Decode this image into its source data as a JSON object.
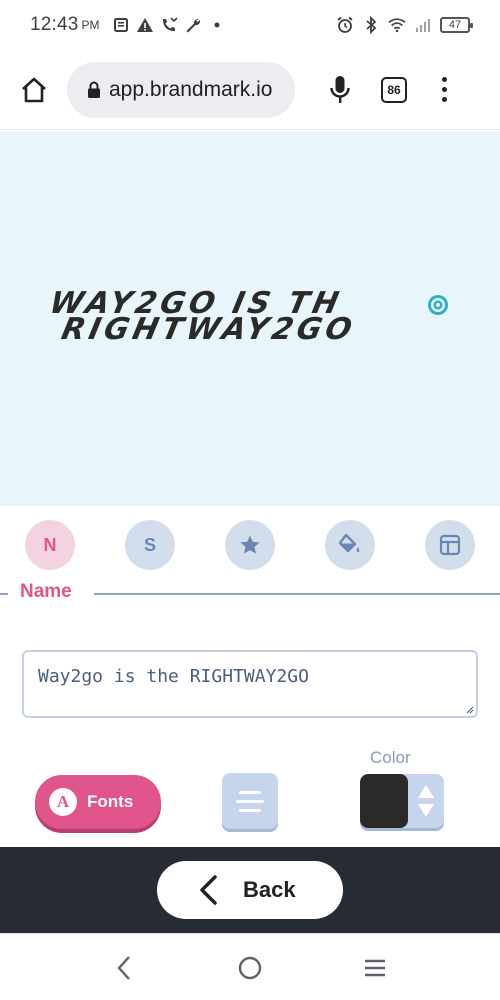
{
  "status_bar": {
    "time": "12:43",
    "ampm": "PM",
    "battery": "47"
  },
  "browser": {
    "url": "app.brandmark.io",
    "tab_count": "86"
  },
  "preview": {
    "logo_line1": "WAY2GO IS TH",
    "logo_line2": "RIGHTWAY2GO",
    "background": "#e8f6fb",
    "logo_color": "#2a2a2a",
    "mark_color": "#2bb3c0"
  },
  "tabs": [
    {
      "letter": "N",
      "icon": "name-icon",
      "active": true
    },
    {
      "letter": "S",
      "icon": "slogan-icon",
      "active": false
    },
    {
      "letter": "",
      "icon": "star-icon",
      "active": false
    },
    {
      "letter": "",
      "icon": "paint-bucket-icon",
      "active": false
    },
    {
      "letter": "",
      "icon": "layout-icon",
      "active": false
    }
  ],
  "section": {
    "title": "Name"
  },
  "name_input": {
    "value": "Way2go is the RIGHTWAY2GO"
  },
  "controls": {
    "fonts_label": "Fonts",
    "fonts_letter": "A",
    "color_label": "Color",
    "selected_color": "#2a2a28",
    "accent": "#e0558c"
  },
  "footer": {
    "back_label": "Back"
  }
}
